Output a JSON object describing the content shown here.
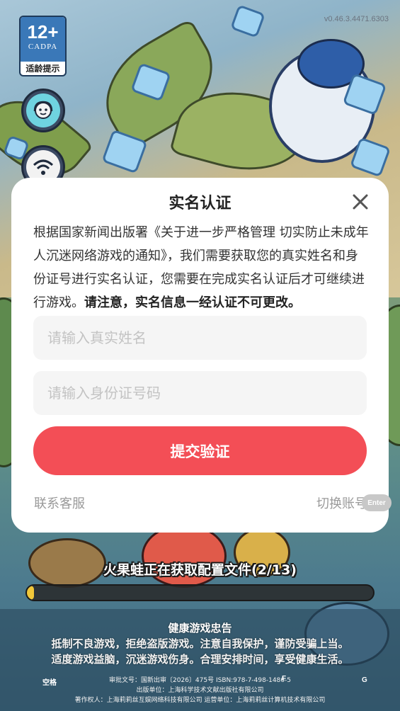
{
  "version": "v0.46.3.4471.6303",
  "age_badge": {
    "rating": "12+",
    "org": "CADPA",
    "label": "适龄提示"
  },
  "side_buttons": [
    {
      "icon": "support-agent-icon"
    },
    {
      "icon": "wifi-icon"
    }
  ],
  "dialog": {
    "title": "实名认证",
    "body_text": "根据国家新闻出版署《关于进一步严格管理 切实防止未成年人沉迷网络游戏的通知》，我们需要获取您的真实姓名和身份证号进行实名认证，您需要在完成实名认证后才可继续进行游戏。",
    "body_bold": "请注意，实名信息一经认证不可更改。",
    "name_placeholder": "请输入真实姓名",
    "name_value": "",
    "id_placeholder": "请输入身份证号码",
    "id_value": "",
    "submit_label": "提交验证",
    "contact_label": "联系客服",
    "switch_label": "切换账号",
    "enter_hint": "Enter",
    "submit_color": "#f34e56"
  },
  "loading": {
    "text": "火果蛙正在获取配置文件(2/13)",
    "progress": 0.02
  },
  "notice": {
    "title": "健康游戏忠告",
    "line1": "抵制不良游戏，拒绝盗版游戏。注意自我保护，谨防受骗上当。",
    "line2": "适度游戏益脑，沉迷游戏伤身。合理安排时间，享受健康生活。"
  },
  "footer": {
    "approval": "审批文号：国新出审〔2026〕475号 ISBN:978-7-498-1486-5",
    "publisher": "出版单位：上海科学技术文献出版社有限公司",
    "copyright": "著作权人：上海莉莉丝互娱网络科技有限公司   运营单位：上海莉莉丝计算机技术有限公司"
  },
  "key_hints": {
    "space": "空格",
    "f": "F",
    "g": "G"
  }
}
